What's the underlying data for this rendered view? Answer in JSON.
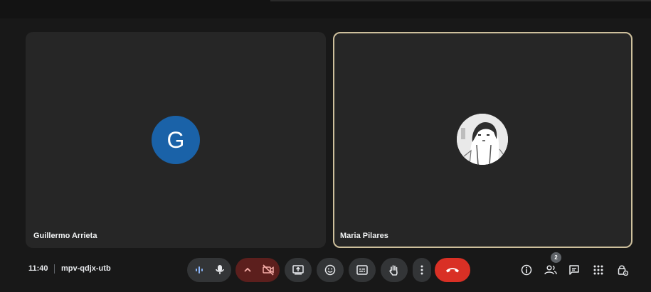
{
  "tiles": [
    {
      "name": "Guillermo Arrieta",
      "avatar_letter": "G",
      "avatar_color": "#1a62a8"
    },
    {
      "name": "Maria Pilares",
      "avatar_icon": "profile-photo"
    }
  ],
  "bottom_bar": {
    "time": "11:40",
    "meeting_code": "mpv-qdjx-utb",
    "people_count": "2"
  },
  "colors": {
    "background": "#181818",
    "tile": "#262626",
    "active_speaker_border": "#cdbf9c",
    "end_call": "#d93025",
    "camera_off": "#5c1f1d"
  }
}
